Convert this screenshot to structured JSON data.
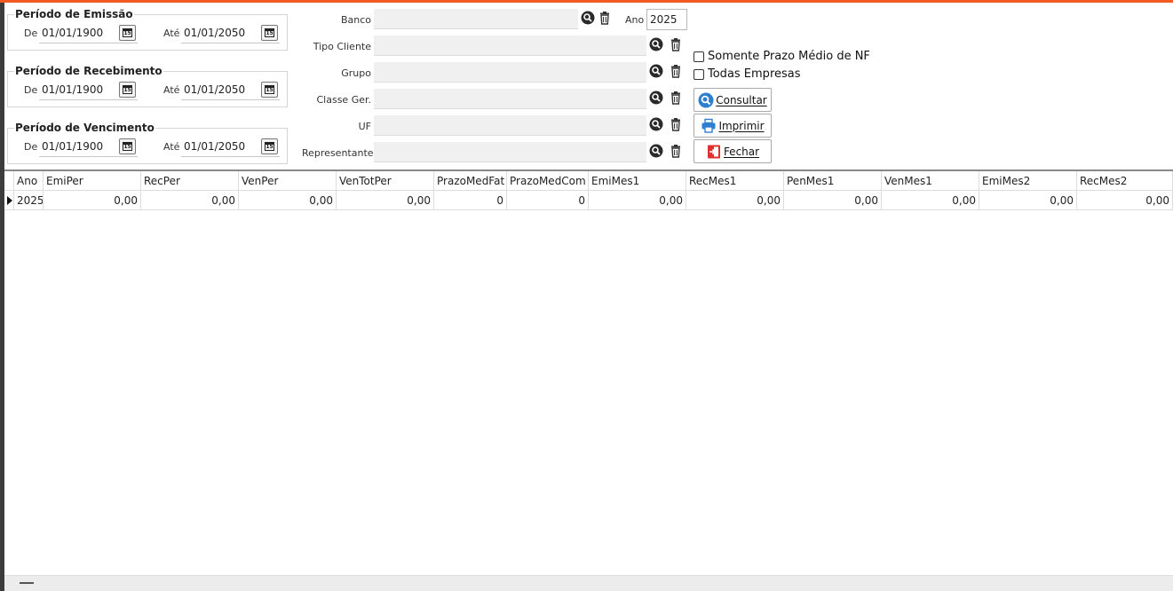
{
  "periodo_emissao": {
    "title": "Período de Emissão",
    "de_label": "De",
    "de_value": "01/01/1900",
    "ate_label": "Até",
    "ate_value": "01/01/2050"
  },
  "periodo_recebimento": {
    "title": "Período de Recebimento",
    "de_label": "De",
    "de_value": "01/01/1900",
    "ate_label": "Até",
    "ate_value": "01/01/2050"
  },
  "periodo_vencimento": {
    "title": "Período de Vencimento",
    "de_label": "De",
    "de_value": "01/01/1900",
    "ate_label": "Até",
    "ate_value": "01/01/2050"
  },
  "filters": {
    "banco": "Banco",
    "tipo_cliente": "Tipo Cliente",
    "grupo": "Grupo",
    "classe_ger": "Classe Ger.",
    "uf": "UF",
    "representante": "Representante"
  },
  "ano": {
    "label": "Ano",
    "value": "2025"
  },
  "options": {
    "somente_prazo": "Somente Prazo Médio de NF",
    "todas_empresas": "Todas Empresas"
  },
  "buttons": {
    "consultar": "Consultar",
    "imprimir": "Imprimir",
    "fechar": "Fechar"
  },
  "grid": {
    "columns": [
      "Ano",
      "EmiPer",
      "RecPer",
      "VenPer",
      "VenTotPer",
      "PrazoMedFat",
      "PrazoMedCom",
      "EmiMes1",
      "RecMes1",
      "PenMes1",
      "VenMes1",
      "EmiMes2",
      "RecMes2"
    ],
    "rows": [
      [
        "2025",
        "0,00",
        "0,00",
        "0,00",
        "0,00",
        "0",
        "0",
        "0,00",
        "0,00",
        "0,00",
        "0,00",
        "0,00",
        "0,00"
      ]
    ]
  },
  "colors": {
    "accent": "#f15a22",
    "search_icon": "#2a2a2a",
    "consultar_icon": "#2f7fd1",
    "fechar_icon": "#e03030"
  }
}
